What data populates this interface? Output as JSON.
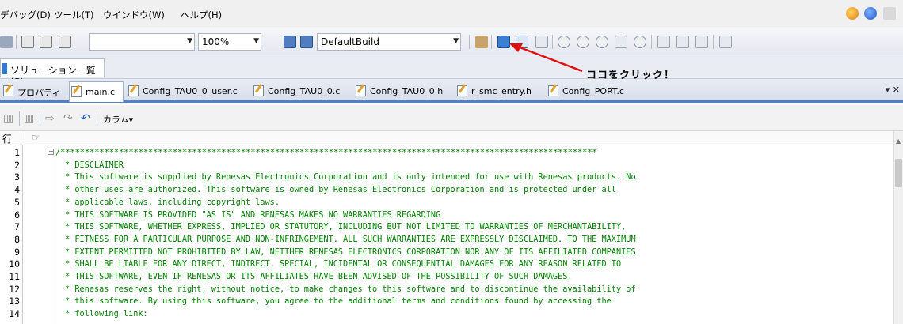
{
  "menu": [
    "デバッグ(D)",
    "ツール(T)",
    "ウインドウ(W)",
    "ヘルプ(H)"
  ],
  "toolbar": {
    "zoom": "100%",
    "build_config": "DefaultBuild"
  },
  "solution_panel": {
    "label": "ソリューション一覧(S)"
  },
  "tabs": [
    {
      "label": "プロパティ"
    },
    {
      "label": "main.c"
    },
    {
      "label": "Config_TAU0_0_user.c"
    },
    {
      "label": "Config_TAU0_0.c"
    },
    {
      "label": "Config_TAU0_0.h"
    },
    {
      "label": "r_smc_entry.h"
    },
    {
      "label": "Config_PORT.c"
    }
  ],
  "tab_overflow": "▾ ✕",
  "editor_toolbar": {
    "column_label": "カラム▾"
  },
  "editor": {
    "header_line": "行",
    "header_icon": "☞",
    "line_numbers": [
      "1",
      "2",
      "3",
      "4",
      "5",
      "6",
      "7",
      "8",
      "9",
      "10",
      "11",
      "12",
      "13",
      "14"
    ],
    "lines": [
      "/**************************************************************************************************************",
      "* DISCLAIMER",
      "* This software is supplied by Renesas Electronics Corporation and is only intended for use with Renesas products. No",
      "* other uses are authorized. This software is owned by Renesas Electronics Corporation and is protected under all",
      "* applicable laws, including copyright laws.",
      "* THIS SOFTWARE IS PROVIDED \"AS IS\" AND RENESAS MAKES NO WARRANTIES REGARDING",
      "* THIS SOFTWARE, WHETHER EXPRESS, IMPLIED OR STATUTORY, INCLUDING BUT NOT LIMITED TO WARRANTIES OF MERCHANTABILITY,",
      "* FITNESS FOR A PARTICULAR PURPOSE AND NON-INFRINGEMENT. ALL SUCH WARRANTIES ARE EXPRESSLY DISCLAIMED. TO THE MAXIMUM",
      "* EXTENT PERMITTED NOT PROHIBITED BY LAW, NEITHER RENESAS ELECTRONICS CORPORATION NOR ANY OF ITS AFFILIATED COMPANIES",
      "* SHALL BE LIABLE FOR ANY DIRECT, INDIRECT, SPECIAL, INCIDENTAL OR CONSEQUENTIAL DAMAGES FOR ANY REASON RELATED TO",
      "* THIS SOFTWARE, EVEN IF RENESAS OR ITS AFFILIATES HAVE BEEN ADVISED OF THE POSSIBILITY OF SUCH DAMAGES.",
      "* Renesas reserves the right, without notice, to make changes to this software and to discontinue the availability of",
      "* this software. By using this software, you agree to the additional terms and conditions found by accessing the",
      "* following link:"
    ]
  },
  "annotation": {
    "text": "ココをクリック！",
    "color": "#e01010"
  }
}
